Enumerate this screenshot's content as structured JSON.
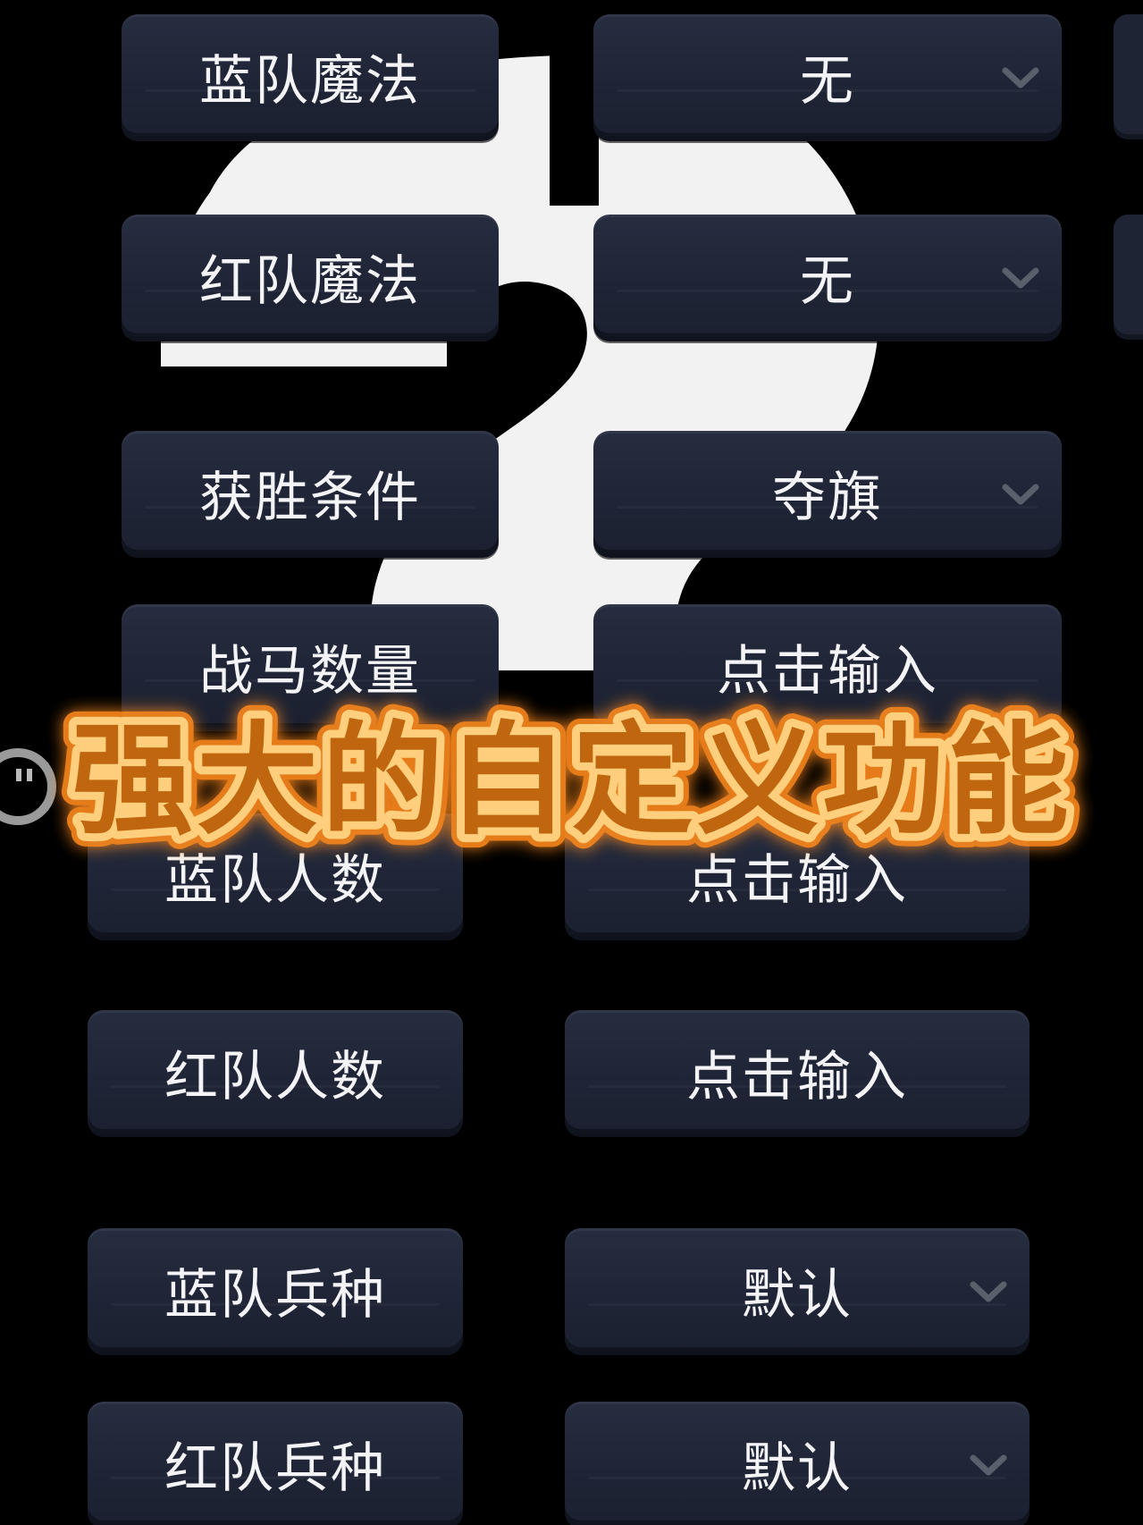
{
  "rows": [
    {
      "label": "蓝队魔法",
      "value": "无",
      "dropdown": true
    },
    {
      "label": "红队魔法",
      "value": "无",
      "dropdown": true
    },
    {
      "label": "获胜条件",
      "value": "夺旗",
      "dropdown": true
    },
    {
      "label": "战马数量",
      "value": "点击输入",
      "dropdown": false
    },
    {
      "label": "蓝队人数",
      "value": "点击输入",
      "dropdown": false
    },
    {
      "label": "红队人数",
      "value": "点击输入",
      "dropdown": false
    },
    {
      "label": "蓝队兵种",
      "value": "默认",
      "dropdown": true
    },
    {
      "label": "红队兵种",
      "value": "默认",
      "dropdown": true
    }
  ],
  "banner": {
    "text": "强大的自定义功能",
    "fill_color": "#c0660e",
    "stroke_color": "#ffcf7d",
    "glow_color": "#ff8a1c"
  },
  "colors": {
    "background": "#000000",
    "pill": "#1f2536",
    "text": "#f4f4f6",
    "chevron": "#5a5f6c"
  },
  "icons": {
    "dropdown": "chevron-down-icon",
    "background_art": "question-mark-icon"
  }
}
